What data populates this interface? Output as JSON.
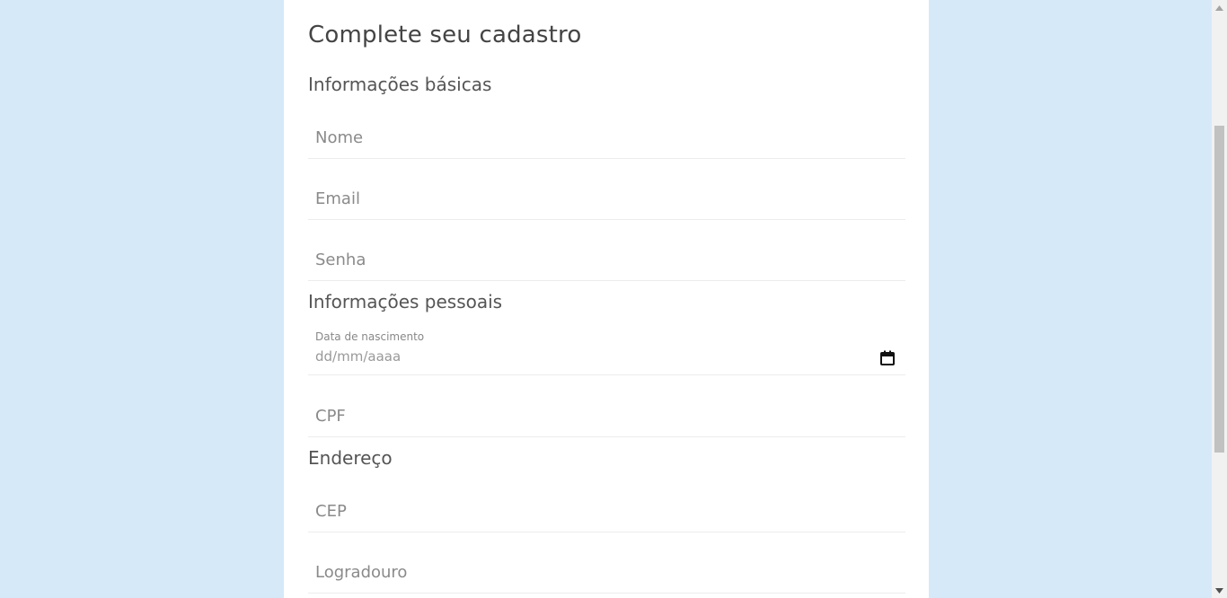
{
  "form": {
    "title": "Complete seu cadastro",
    "sections": {
      "basic": "Informações básicas",
      "personal": "Informações pessoais",
      "address": "Endereço"
    },
    "fields": {
      "nome": {
        "placeholder": "Nome",
        "value": ""
      },
      "email": {
        "placeholder": "Email",
        "value": ""
      },
      "senha": {
        "placeholder": "Senha",
        "value": ""
      },
      "data_nascimento": {
        "label": "Data de nascimento",
        "display": "dd/mm/aaaa"
      },
      "cpf": {
        "placeholder": "CPF",
        "value": ""
      },
      "cep": {
        "placeholder": "CEP",
        "value": ""
      },
      "logradouro": {
        "placeholder": "Logradouro",
        "value": ""
      }
    }
  },
  "icons": {
    "calendar": "calendar-icon",
    "scroll_up": "chevron-up-icon",
    "scroll_down": "chevron-down-icon"
  },
  "colors": {
    "background": "#d6e9f8",
    "card": "#ffffff",
    "text": "#444444",
    "placeholder": "#8a8a8a",
    "divider": "#ececec"
  },
  "scroll": {
    "position": 0.21
  }
}
